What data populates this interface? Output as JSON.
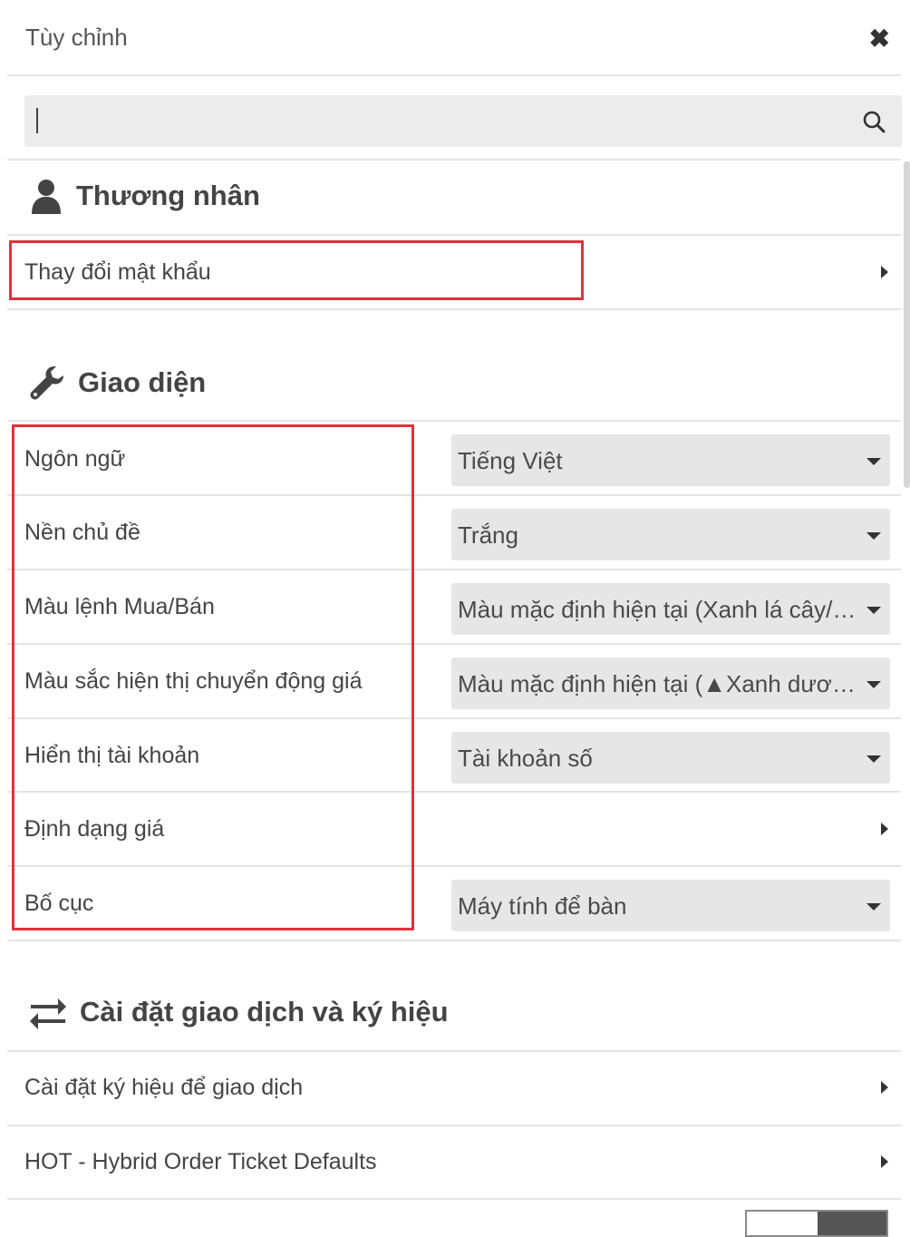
{
  "header": {
    "title": "Tùy chỉnh",
    "close_symbol": "✖"
  },
  "search": {
    "value": ""
  },
  "sections": {
    "trader": {
      "title": "Thương nhân",
      "icon": "user-icon",
      "items": [
        {
          "label": "Thay đổi mật khẩu"
        }
      ]
    },
    "interface": {
      "title": "Giao diện",
      "icon": "wrench-icon",
      "items": [
        {
          "label": "Ngôn ngữ",
          "value": "Tiếng Việt"
        },
        {
          "label": "Nền chủ đề",
          "value": "Trắng"
        },
        {
          "label": "Màu lệnh Mua/Bán",
          "value": "Màu mặc định hiện tại (Xanh lá cây/…"
        },
        {
          "label": "Màu sắc hiện thị chuyển động giá",
          "value": "Màu mặc định hiện tại (▲Xanh dươ…"
        },
        {
          "label": "Hiển thị tài khoản",
          "value": "Tài khoản số"
        },
        {
          "label": "Định dạng giá"
        },
        {
          "label": "Bố cục",
          "value": "Máy tính để bàn"
        }
      ]
    },
    "trading": {
      "title": "Cài đặt giao dịch và ký hiệu",
      "icon": "exchange-arrows-icon",
      "items": [
        {
          "label": "Cài đặt ký hiệu để giao dịch"
        },
        {
          "label": "HOT - Hybrid Order Ticket Defaults"
        }
      ]
    }
  },
  "colors": {
    "highlight": "#e0323c",
    "select_bg": "#e6e6e6",
    "search_bg": "#ececec"
  }
}
